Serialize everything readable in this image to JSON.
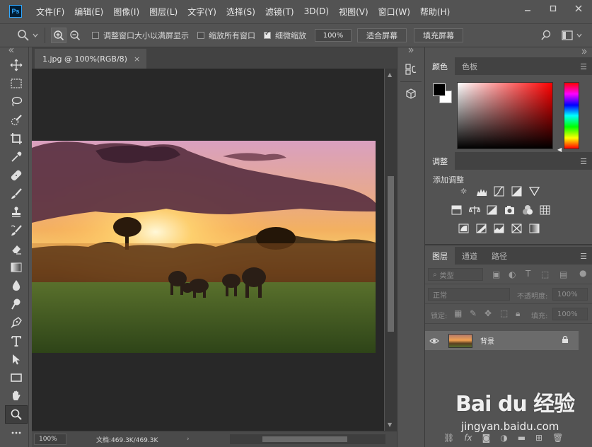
{
  "app": {
    "logo_text": "Ps"
  },
  "menu": [
    "文件(F)",
    "编辑(E)",
    "图像(I)",
    "图层(L)",
    "文字(Y)",
    "选择(S)",
    "滤镜(T)",
    "3D(D)",
    "视图(V)",
    "窗口(W)",
    "帮助(H)"
  ],
  "options": {
    "resize_windows_label": "调整窗口大小以满屏显示",
    "zoom_all_label": "缩放所有窗口",
    "scrubby_zoom_label": "细微缩放",
    "zoom_percent": "100%",
    "fit_screen_label": "适合屏幕",
    "fill_screen_label": "填充屏幕"
  },
  "document": {
    "tab_title": "1.jpg @ 100%(RGB/8)",
    "close_glyph": "×",
    "status_zoom": "100%",
    "status_doc": "文档:469.3K/469.3K",
    "status_arrow": "›"
  },
  "color_panel": {
    "tabs": [
      "颜色",
      "色板"
    ],
    "foreground": "#000000",
    "background": "#ffffff"
  },
  "adjustments_panel": {
    "tabs": [
      "调整"
    ],
    "title": "添加调整"
  },
  "layers_panel": {
    "tabs": [
      "图层",
      "通道",
      "路径"
    ],
    "filter_kind": "类型",
    "blend_mode": "正常",
    "opacity_label": "不透明度:",
    "opacity_value": "100%",
    "lock_label": "锁定:",
    "fill_label": "填充:",
    "fill_value": "100%",
    "layers": [
      {
        "name": "背景",
        "visible": true,
        "locked": true
      }
    ]
  },
  "footer_icons": [
    "link-icon",
    "fx-icon",
    "mask-icon",
    "adjustment-layer-icon",
    "group-icon",
    "new-layer-icon",
    "trash-icon"
  ],
  "watermark": {
    "logo": "Bai du 经验",
    "sub": "jingyan.baidu.com"
  }
}
